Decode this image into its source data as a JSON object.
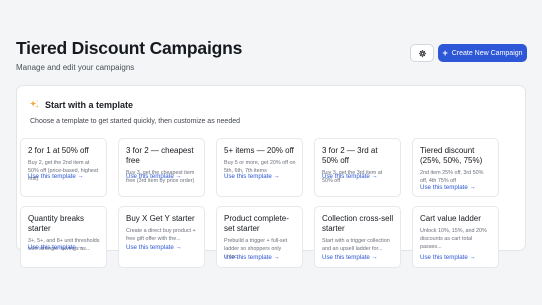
{
  "header": {
    "title": "Tiered Discount Campaigns",
    "subtitle": "Manage and edit your campaigns",
    "settings_icon": "gear-icon",
    "create_label": "Create New Campaign"
  },
  "templates": {
    "title": "Start with a template",
    "icon": "sparkles-icon",
    "description": "Choose a template to get started quickly, then customize as needed",
    "link_label": "Use this template →",
    "items": [
      {
        "title": "2 for 1 at 50% off",
        "desc": "Buy 2, get the 2nd item at 50% off (price-based, highest first)"
      },
      {
        "title": "3 for 2 — cheapest free",
        "desc": "Buy 3, get the cheapest item free (3rd item by price order)"
      },
      {
        "title": "5+ items — 20% off",
        "desc": "Buy 5 or more, get 20% off on 5th, 6th, 7th items"
      },
      {
        "title": "3 for 2 — 3rd at 50% off",
        "desc": "Buy 3, get the 3rd item at 50% off"
      },
      {
        "title": "Tiered discount (25%, 50%, 75%)",
        "desc": "2nd item 25% off, 3rd 50% off, 4th 75% off"
      },
      {
        "title": "Quantity breaks starter",
        "desc": "3+, 5+, and 8+ unit thresholds with stronger savings as..."
      },
      {
        "title": "Buy X Get Y starter",
        "desc": "Create a direct buy product + free gift offer with the..."
      },
      {
        "title": "Product complete-set starter",
        "desc": "Prebuild a trigger + full-set ladder so shoppers only unloc..."
      },
      {
        "title": "Collection cross-sell starter",
        "desc": "Start with a trigger collection and an upsell ladder for..."
      },
      {
        "title": "Cart value ladder",
        "desc": "Unlock 10%, 15%, and 20% discounts as cart total passes..."
      }
    ]
  }
}
